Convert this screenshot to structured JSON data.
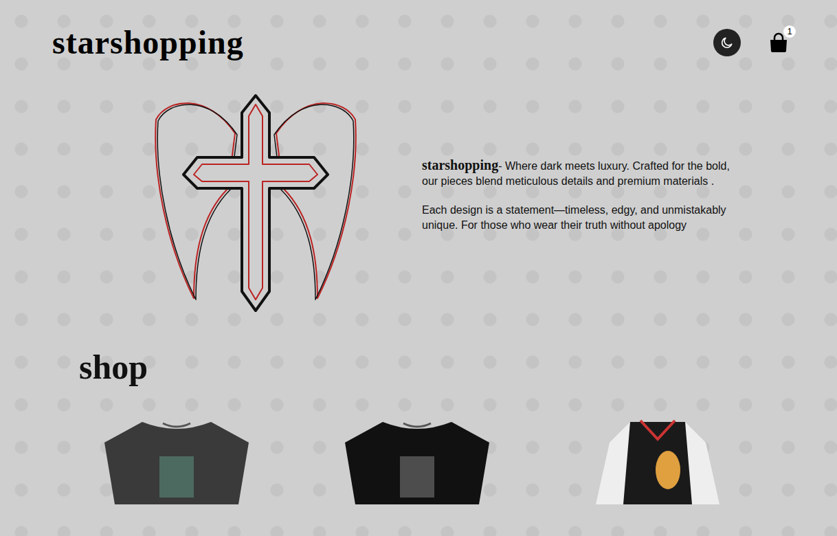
{
  "header": {
    "logo": "starshopping",
    "theme_toggle": {
      "dark": false
    },
    "cart": {
      "count": "1"
    }
  },
  "hero": {
    "brand": "starshopping",
    "tagline": "- Where dark meets luxury. Crafted for the bold, our pieces blend meticulous details and premium materials .",
    "statement": "Each design is a statement—timeless, edgy, and unmistakably unique. For those who wear their truth without apology"
  },
  "shop": {
    "title": "shop",
    "products": [
      {
        "kind": "tshirt-grey"
      },
      {
        "kind": "tshirt-black"
      },
      {
        "kind": "jacket"
      }
    ]
  }
}
